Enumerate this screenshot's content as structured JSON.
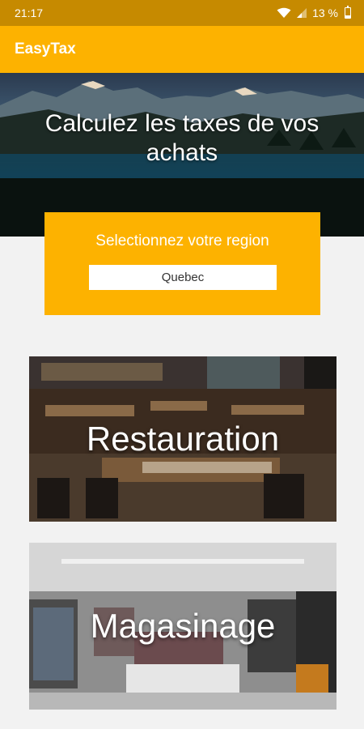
{
  "status_bar": {
    "time": "21:17",
    "battery": "13 %"
  },
  "app_bar": {
    "title": "EasyTax"
  },
  "hero": {
    "title": "Calculez les taxes de vos achats"
  },
  "region": {
    "label": "Selectionnez votre region",
    "selected": "Quebec"
  },
  "categories": [
    {
      "label": "Restauration"
    },
    {
      "label": "Magasinage"
    }
  ],
  "colors": {
    "accent": "#fdb200",
    "status_bar": "#c68a00",
    "background": "#f2f2f2"
  },
  "icons": [
    "wifi-icon",
    "signal-icon",
    "battery-icon"
  ]
}
